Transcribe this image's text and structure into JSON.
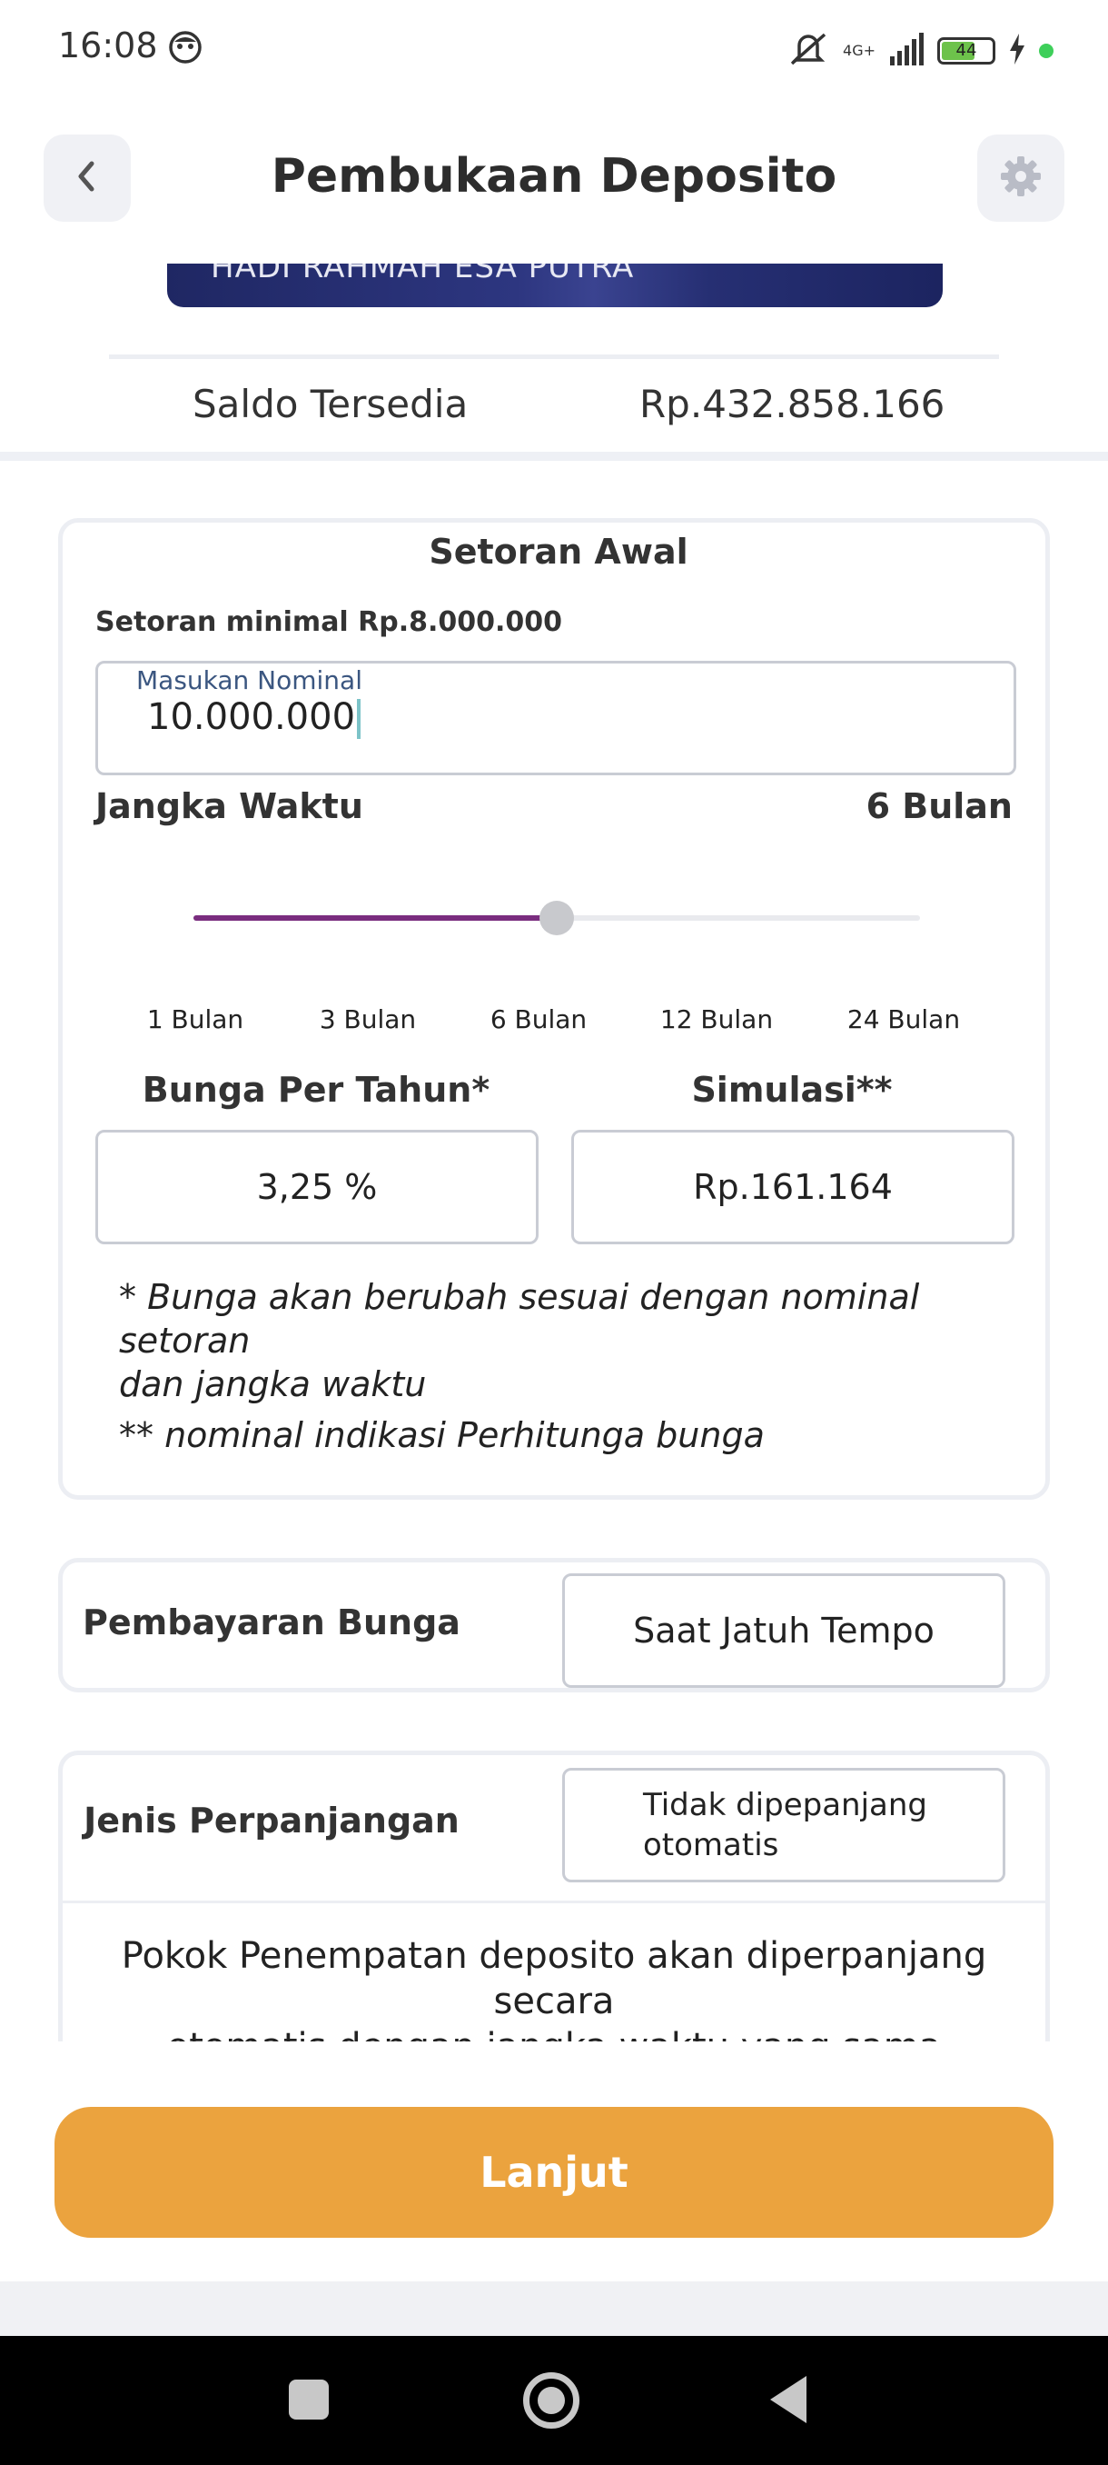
{
  "status_bar": {
    "time": "16:08",
    "network": "4G+",
    "battery": "44",
    "colors": {
      "battery_fill": "#6dc24b",
      "indicator_dot": "#3ecf5a"
    }
  },
  "header": {
    "title": "Pembukaan Deposito",
    "back_icon": "chevron-left-icon",
    "settings_icon": "gear-icon"
  },
  "account": {
    "name": "HADI RAHMAH ESA PUTRA",
    "saldo_label": "Saldo Tersedia",
    "saldo_value": "Rp.432.858.166"
  },
  "setoran": {
    "title": "Setoran Awal",
    "min_text": "Setoran minimal Rp.8.000.000",
    "nominal_label": "Masukan Nominal",
    "nominal_value": "10.000.000",
    "term_label": "Jangka Waktu",
    "term_value": "6 Bulan",
    "term_options": [
      "1 Bulan",
      "3 Bulan",
      "6 Bulan",
      "12 Bulan",
      "24 Bulan"
    ],
    "term_selected_index": 2,
    "slider_fraction": 0.5,
    "interest_label": "Bunga Per Tahun*",
    "interest_value": "3,25 %",
    "simulation_label": "Simulasi**",
    "simulation_value": "Rp.161.164",
    "note1_line1": "* Bunga akan berubah sesuai dengan nominal",
    "note1_line2": "setoran",
    "note1_line3": "dan jangka waktu",
    "note2": "** nominal indikasi Perhitunga bunga",
    "colors": {
      "slider_fill": "#7a2d7f",
      "slider_thumb": "#c8c9cd"
    }
  },
  "pembayaran": {
    "label": "Pembayaran Bunga",
    "value": "Saat Jatuh Tempo"
  },
  "perpanjangan": {
    "label": "Jenis Perpanjangan",
    "value_line1": "Tidak dipepanjang",
    "value_line2": "otomatis",
    "desc_line1": "Pokok Penempatan deposito akan diperpanjang secara",
    "desc_line2": "otomatis dengan jangka waktu yang sama"
  },
  "footer": {
    "button_label": "Lanjut",
    "colors": {
      "button": "#eba33e"
    }
  },
  "nav": {
    "icons": [
      "recent-apps-icon",
      "home-icon",
      "back-icon"
    ]
  }
}
